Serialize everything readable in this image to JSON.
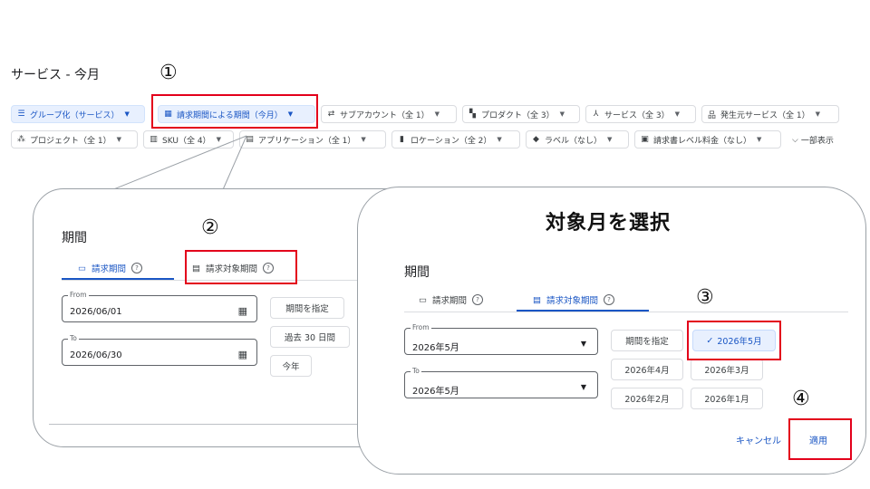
{
  "page_title": "サービス - 今月",
  "filters_row1": [
    {
      "label": "グループ化（サービス）",
      "icon": "list-icon",
      "active": true
    },
    {
      "label": "請求期間による期間（今月）",
      "icon": "calendar-icon",
      "active": true
    },
    {
      "label": "サブアカウント（全 1）",
      "icon": "swap-icon",
      "active": false
    },
    {
      "label": "プロダクト（全 3）",
      "icon": "grid-icon",
      "active": false
    },
    {
      "label": "サービス（全 3）",
      "icon": "tree-icon",
      "active": false
    },
    {
      "label": "発生元サービス（全 1）",
      "icon": "hierarchy-icon",
      "active": false
    }
  ],
  "filters_row2": [
    {
      "label": "プロジェクト（全 1）",
      "icon": "project-icon"
    },
    {
      "label": "SKU（全 4）",
      "icon": "barcode-icon"
    },
    {
      "label": "アプリケーション（全 1）",
      "icon": "app-icon"
    },
    {
      "label": "ロケーション（全 2）",
      "icon": "location-icon"
    },
    {
      "label": "ラベル（なし）",
      "icon": "label-icon"
    },
    {
      "label": "請求書レベル料金（なし）",
      "icon": "invoice-icon"
    }
  ],
  "show_less": "一部表示",
  "steps": [
    "①",
    "②",
    "③",
    "④"
  ],
  "panel1": {
    "title": "期間",
    "tab_billing": "請求期間",
    "tab_invoice": "請求対象期間",
    "from_label": "From",
    "from_value": "2026/06/01",
    "to_label": "To",
    "to_value": "2026/06/30",
    "btn_custom": "期間を指定",
    "btn_last30": "過去 30 日間",
    "btn_this_year": "今年"
  },
  "panel2": {
    "heading": "対象月を選択",
    "title": "期間",
    "tab_billing": "請求期間",
    "tab_invoice": "請求対象期間",
    "from_label": "From",
    "from_value": "2026年5月",
    "to_label": "To",
    "to_value": "2026年5月",
    "btn_custom": "期間を指定",
    "months": [
      "2026年5月",
      "2026年4月",
      "2026年3月",
      "2026年2月",
      "2026年1月"
    ],
    "selected_check": "✓",
    "cancel": "キャンセル",
    "apply": "適用"
  },
  "colors": {
    "accent": "#1a56c4",
    "highlight": "#e3001b"
  }
}
